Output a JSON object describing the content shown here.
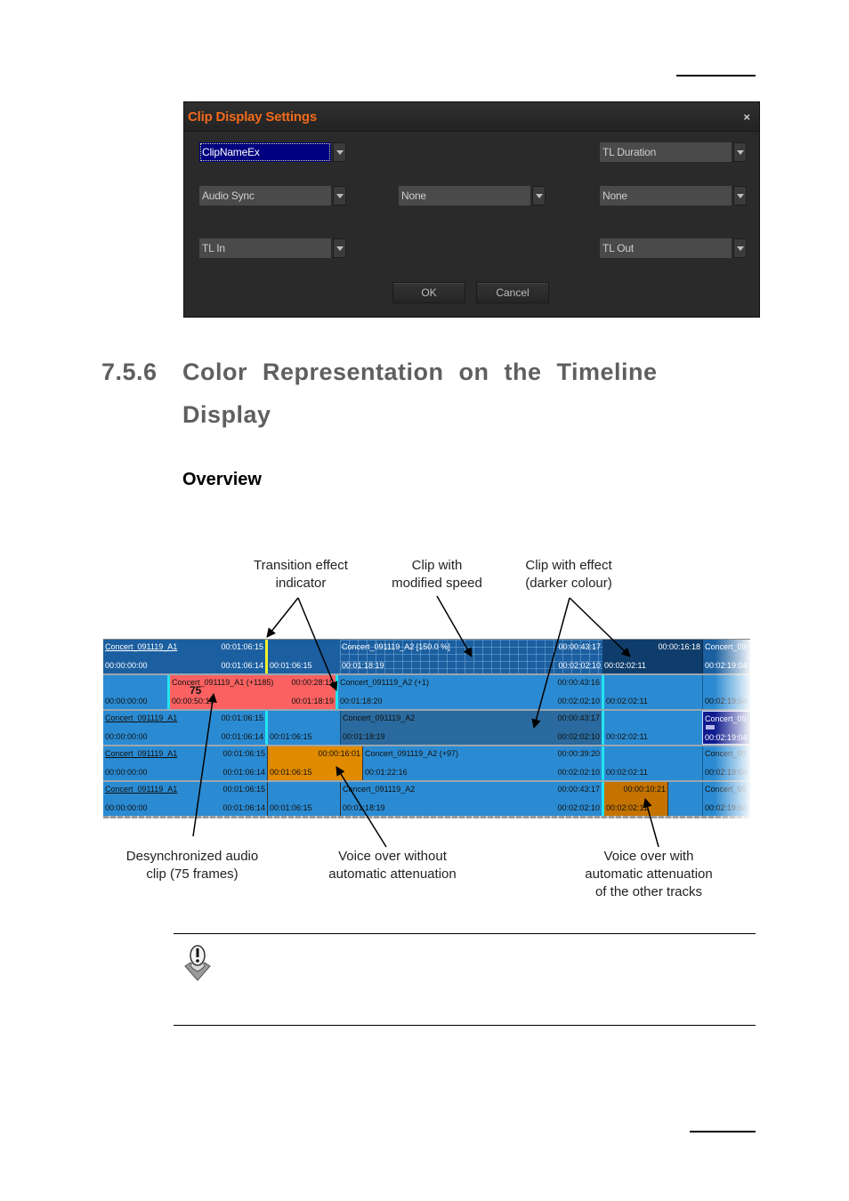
{
  "dialog": {
    "title": "Clip Display Settings",
    "close_label": "×",
    "fields": {
      "row1_left": "ClipNameEx",
      "row1_right": "TL Duration",
      "row2_left": "Audio Sync",
      "row2_mid": "None",
      "row2_right": "None",
      "row3_left": "TL In",
      "row3_right": "TL Out"
    },
    "ok_label": "OK",
    "cancel_label": "Cancel"
  },
  "section": {
    "number": "7.5.6",
    "title_line1": "Color Representation on the Timeline",
    "title_line2": "Display",
    "subheading": "Overview"
  },
  "figure": {
    "callouts": {
      "transition": [
        "Transition effect",
        "indicator"
      ],
      "speed": [
        "Clip with",
        "modified speed"
      ],
      "effect": [
        "Clip with effect",
        "(darker colour)"
      ],
      "desync": [
        "Desynchronized audio",
        "clip (75 frames)"
      ],
      "voiceover_no_att": [
        "Voice over without",
        "automatic attenuation"
      ],
      "voiceover_att": [
        "Voice over with",
        "automatic attenuation",
        "of the other tracks"
      ]
    },
    "colors": {
      "track_blue": "#2b8bd2",
      "dark_blue": "#1b5fa0",
      "effect_blue": "#2a6a9e",
      "desync_red": "#fb6161",
      "voiceover_orange": "#e08a00",
      "voiceover_att_orange": "#c47300",
      "transition_yellow": "#f1f12a",
      "transition_cyan": "#23e4f0",
      "selected_navy": "#0e1a8e"
    },
    "tracks": [
      {
        "clips": [
          {
            "tl": "Concert_091119_A1",
            "bl": "00:00:00:00",
            "tr": "00:01:06:15",
            "br": "00:01:06:14"
          },
          {
            "tl": "",
            "bl": "00:01:06:15",
            "tr": "",
            "br": ""
          },
          {
            "tl": "Concert_091119_A2 [150.0 %]",
            "bl": "00:01:18:19",
            "tr": "00:00:43:17",
            "br": "00:02:02:10"
          },
          {
            "tl": "",
            "bl": "00:02:02:11",
            "tr": "00:00:16:18",
            "br": ""
          },
          {
            "tl": "Concert_09",
            "bl": "00:02:19:04",
            "tr": "",
            "br": ""
          }
        ]
      },
      {
        "clips": [
          {
            "tl": "",
            "bl": "00:00:00:00",
            "tr": "",
            "br": ""
          },
          {
            "tl": "Concert_091119_A1 (+1185)",
            "bl": "00:00:50:19",
            "tr": "00:00:28:19",
            "br": "00:01:18:19",
            "badge": "75"
          },
          {
            "tl": "Concert_091119_A2 (+1)",
            "bl": "00:01:18:20",
            "tr": "00:00:43:16",
            "br": "00:02:02:10"
          },
          {
            "tl": "",
            "bl": "00:02:02:11",
            "tr": "",
            "br": ""
          },
          {
            "tl": "",
            "bl": "00:02:19:04",
            "tr": "",
            "br": ""
          }
        ]
      },
      {
        "clips": [
          {
            "tl": "Concert_091119_A1",
            "bl": "00:00:00:00",
            "tr": "00:01:06:15",
            "br": "00:01:06:14"
          },
          {
            "tl": "",
            "bl": "00:01:06:15",
            "tr": "",
            "br": ""
          },
          {
            "tl": "Concert_091119_A2",
            "bl": "00:01:18:19",
            "tr": "00:00:43:17",
            "br": "00:02:02:10"
          },
          {
            "tl": "",
            "bl": "00:02:02:11",
            "tr": "",
            "br": ""
          },
          {
            "tl": "Concert_09",
            "bl": "00:02:19:04",
            "tr": "",
            "br": ""
          }
        ]
      },
      {
        "clips": [
          {
            "tl": "Concert_091119_A1",
            "bl": "00:00:00:00",
            "tr": "00:01:06:15",
            "br": "00:01:06:14"
          },
          {
            "tl": "",
            "bl": "00:01:06:15",
            "tr": "00:00:16:01",
            "br": ""
          },
          {
            "tl": "Concert_091119_A2 (+97)",
            "bl": "00:01:22:16",
            "tr": "00:00:39:20",
            "br": "00:02:02:10"
          },
          {
            "tl": "",
            "bl": "00:02:02:11",
            "tr": "",
            "br": ""
          },
          {
            "tl": "Concert_09",
            "bl": "00:02:19:04",
            "tr": "",
            "br": ""
          }
        ]
      },
      {
        "clips": [
          {
            "tl": "Concert_091119_A1",
            "bl": "00:00:00:00",
            "tr": "00:01:06:15",
            "br": "00:01:06:14"
          },
          {
            "tl": "",
            "bl": "00:01:06:15",
            "tr": "",
            "br": ""
          },
          {
            "tl": "Concert_091119_A2",
            "bl": "00:01:18:19",
            "tr": "00:00:43:17",
            "br": "00:02:02:10"
          },
          {
            "tl": "",
            "bl": "00:02:02:11",
            "tr": "00:00:10:21",
            "br": ""
          },
          {
            "tl": "Concert_09",
            "bl": "00:02:19:04",
            "tr": "",
            "br": ""
          }
        ]
      }
    ]
  }
}
